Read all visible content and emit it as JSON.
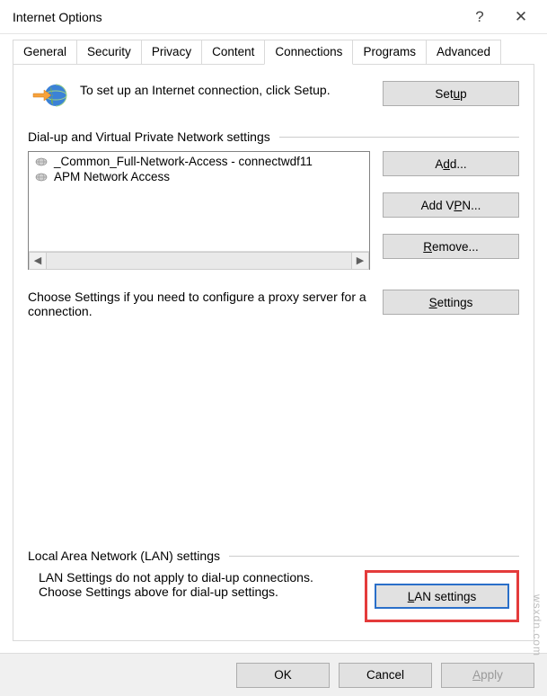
{
  "window": {
    "title": "Internet Options",
    "help_label": "?",
    "close_label": "✕"
  },
  "tabs": {
    "items": [
      "General",
      "Security",
      "Privacy",
      "Content",
      "Connections",
      "Programs",
      "Advanced"
    ],
    "active_index": 4
  },
  "intro": {
    "text": "To set up an Internet connection, click Setup.",
    "setup_label": "Setup",
    "setup_key": "u"
  },
  "dial_group": {
    "title": "Dial-up and Virtual Private Network settings",
    "items": [
      "_Common_Full-Network-Access - connectwdf11",
      "APM Network Access"
    ],
    "add_label": "Add...",
    "addvpn_label": "Add VPN...",
    "remove_label": "Remove...",
    "settings_label": "Settings",
    "choose_text": "Choose Settings if you need to configure a proxy server for a connection."
  },
  "lan_group": {
    "title": "Local Area Network (LAN) settings",
    "text": "LAN Settings do not apply to dial-up connections. Choose Settings above for dial-up settings.",
    "btn_label": "LAN settings"
  },
  "footer": {
    "ok": "OK",
    "cancel": "Cancel",
    "apply": "Apply"
  },
  "watermark": "wsxdn.com"
}
